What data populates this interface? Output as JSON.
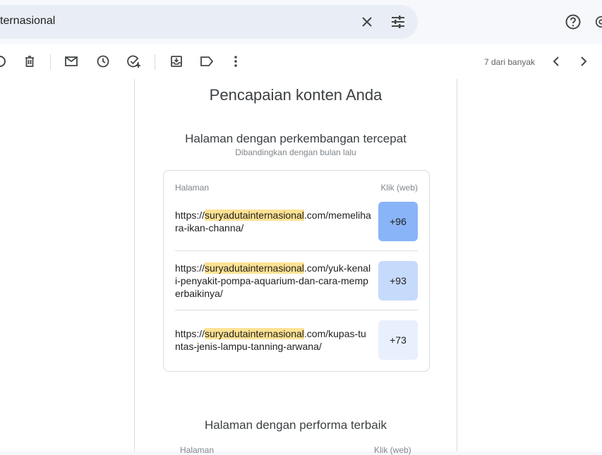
{
  "search": {
    "query": "ternasional"
  },
  "toolbar": {
    "pager_text": "7 dari banyak"
  },
  "report": {
    "title": "Pencapaian konten Anda",
    "section1": {
      "title": "Halaman dengan perkembangan tercepat",
      "subtitle": "Dibandingkan dengan bulan lalu",
      "col_page": "Halaman",
      "col_clicks": "Klik (web)",
      "rows": [
        {
          "prefix": "https://",
          "highlight": "suryadutainternasional",
          "suffix": ".com/memelihara-ikan-channa/",
          "value": "+96",
          "color": "#8ab4f8"
        },
        {
          "prefix": "https://",
          "highlight": "suryadutainternasional",
          "suffix": ".com/yuk-kenali-penyakit-pompa-aquarium-dan-cara-memperbaikinya/",
          "value": "+93",
          "color": "#c6dafc"
        },
        {
          "prefix": "https://",
          "highlight": "suryadutainternasional",
          "suffix": ".com/kupas-tuntas-jenis-lampu-tanning-arwana/",
          "value": "+73",
          "color": "#e8f0fe"
        }
      ]
    },
    "section2": {
      "title": "Halaman dengan performa terbaik",
      "col_page": "Halaman",
      "col_clicks": "Klik (web)"
    }
  }
}
